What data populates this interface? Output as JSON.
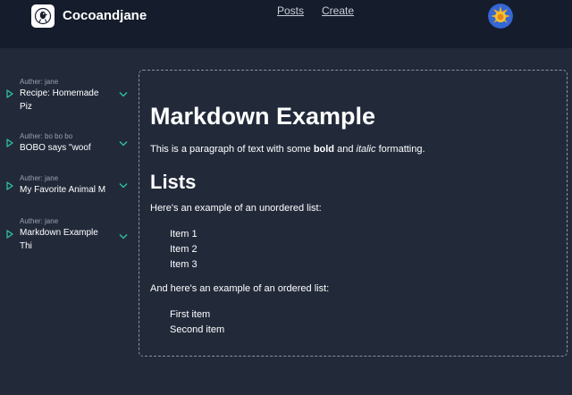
{
  "header": {
    "brand_name": "Cocoandjane",
    "nav": {
      "posts": "Posts",
      "create": "Create"
    },
    "brand_icon": "bird-logo-icon",
    "avatar_icon": "sun-avatar-icon"
  },
  "sidebar": {
    "items": [
      {
        "author": "Auther: jane",
        "title": "Recipe: Homemade Piz"
      },
      {
        "author": "Auther: bo bo bo",
        "title": "BOBO says \"woof"
      },
      {
        "author": "Auther: jane",
        "title": "My Favorite Animal M"
      },
      {
        "author": "Auther: jane",
        "title": "Markdown Example Thi"
      }
    ],
    "play_icon": "play-outline-icon",
    "chevron_icon": "chevron-down-icon"
  },
  "content": {
    "h1": "Markdown Example",
    "p1": {
      "before": "This is a paragraph of text with some ",
      "bold": "bold",
      "middle": " and ",
      "italic": "italic",
      "after": " formatting."
    },
    "h2": "Lists",
    "p2": "Here's an example of an unordered list:",
    "ul": [
      "Item 1",
      "Item 2",
      "Item 3"
    ],
    "p3": "And here's an example of an ordered list:",
    "ol": [
      "First item",
      "Second item"
    ]
  },
  "colors": {
    "background": "#222a3a",
    "header": "#151c2b",
    "accent_teal": "#2fc7a4",
    "text": "#ffffff",
    "muted": "#9aa2b1"
  }
}
